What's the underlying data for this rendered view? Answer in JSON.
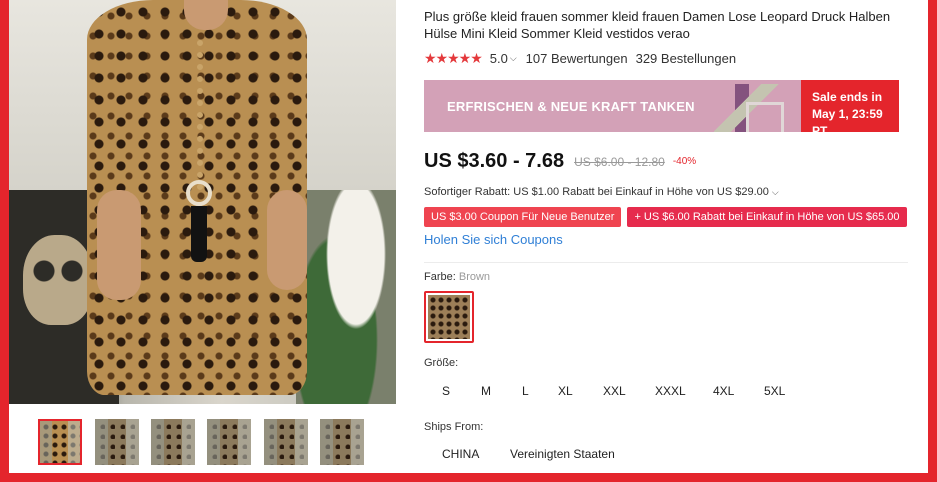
{
  "product": {
    "title": "Plus größe kleid frauen sommer kleid frauen Damen Lose Leopard Druck Halben Hülse Mini Kleid Sommer Kleid vestidos verao",
    "stars": "★★★★★",
    "rating": "5.0",
    "reviews": "107 Bewertungen",
    "orders": "329 Bestellungen"
  },
  "banner": {
    "text": "ERFRISCHEN & NEUE KRAFT TANKEN",
    "sale_line1": "Sale ends in",
    "sale_line2": "May 1, 23:59 PT"
  },
  "price": {
    "current": "US $3.60 - 7.68",
    "original": "US $6.00 - 12.80",
    "discount": "-40%"
  },
  "promotions": {
    "instant_rebate": "Sofortiger Rabatt: US $1.00 Rabatt bei Einkauf in Höhe von US $29.00",
    "coupon_new_user": "US $3.00 Coupon Für Neue Benutzer",
    "coupon_discount": "+ US $6.00 Rabatt bei Einkauf in Höhe von US $65.00",
    "get_coupons": "Holen Sie sich Coupons"
  },
  "color": {
    "label": "Farbe:",
    "value": "Brown"
  },
  "size": {
    "label": "Größe:",
    "options": [
      "S",
      "M",
      "L",
      "XL",
      "XXL",
      "XXXL",
      "4XL",
      "5XL"
    ]
  },
  "ships_from": {
    "label": "Ships From:",
    "options": [
      "CHINA",
      "Vereinigten Staaten"
    ]
  },
  "colors": {
    "accent": "#e4252c",
    "link": "#2f7fd6",
    "banner": "#d3a1b7"
  }
}
